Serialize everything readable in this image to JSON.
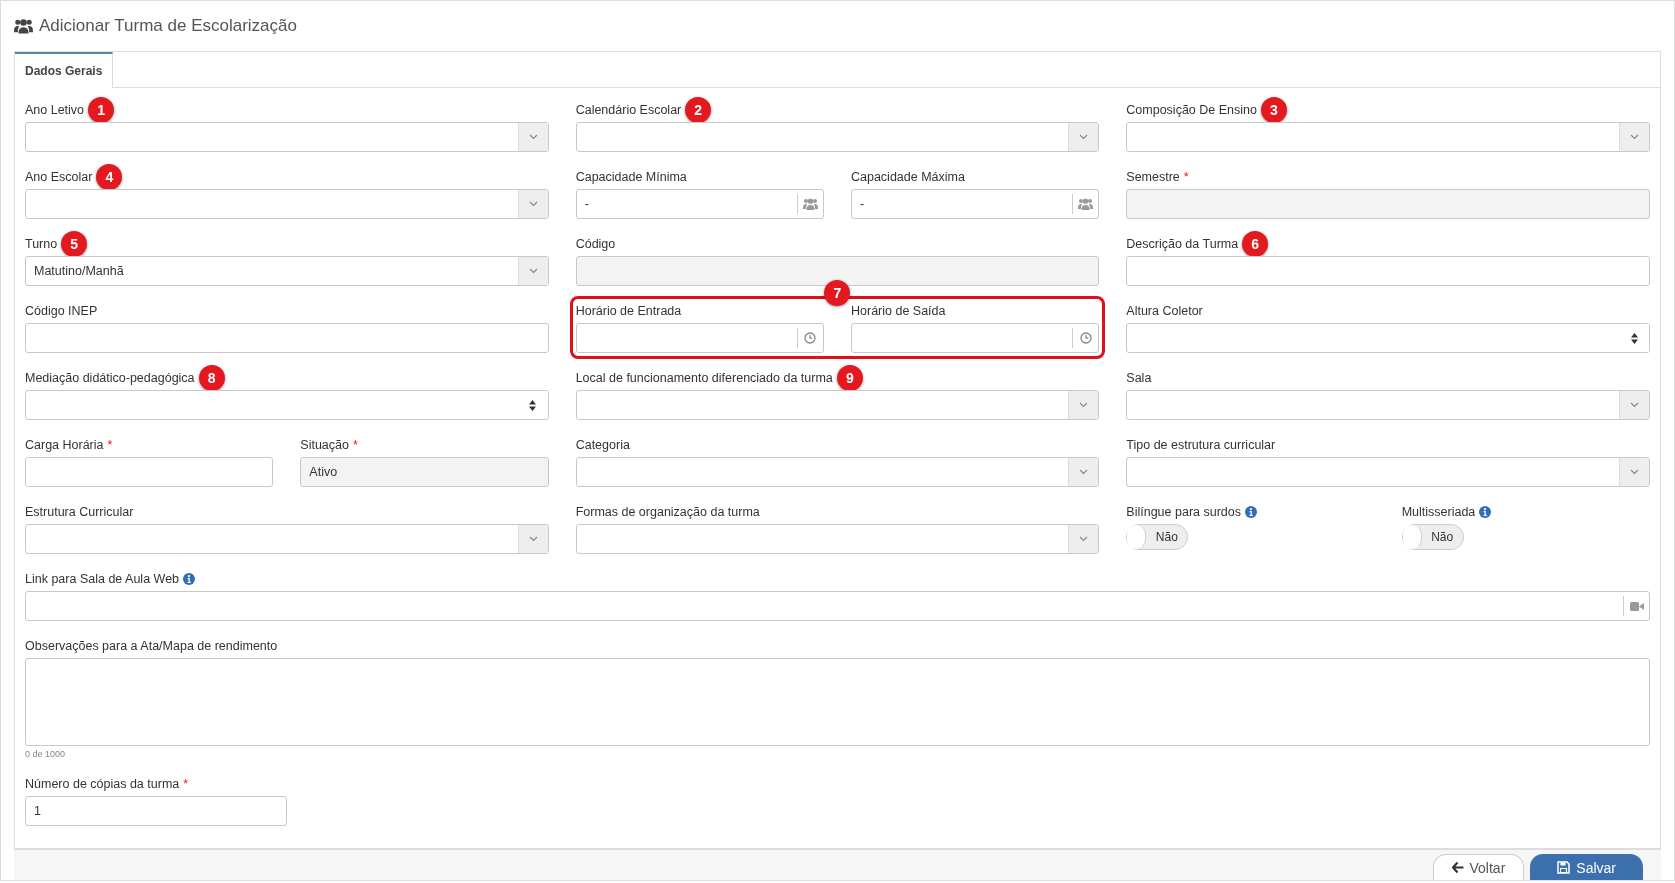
{
  "header": {
    "title": "Adicionar Turma de Escolarização"
  },
  "tabs": [
    {
      "label": "Dados Gerais",
      "selected": true
    }
  ],
  "rows": [
    {
      "cells": [
        {
          "fields": [
            {
              "label": "Ano Letivo",
              "kind": "select",
              "marker": "1"
            }
          ]
        },
        {
          "fields": [
            {
              "label": "Calendário Escolar",
              "kind": "select",
              "marker": "2"
            }
          ]
        },
        {
          "fields": [
            {
              "label": "Composição De Ensino",
              "kind": "select",
              "marker": "3"
            }
          ]
        }
      ]
    },
    {
      "cells": [
        {
          "fields": [
            {
              "label": "Ano Escolar",
              "kind": "select",
              "marker": "4"
            }
          ]
        },
        {
          "fields": [
            {
              "label": "Capacidade Mínima",
              "kind": "people",
              "value": "-"
            },
            {
              "label": "Capacidade Máxima",
              "kind": "people",
              "value": "-"
            }
          ]
        },
        {
          "fields": [
            {
              "label": "Semestre",
              "kind": "text",
              "required": "*",
              "disabled": true
            }
          ]
        }
      ]
    },
    {
      "cells": [
        {
          "fields": [
            {
              "label": "Turno",
              "kind": "select",
              "marker": "5",
              "value": "Matutino/Manhã"
            }
          ]
        },
        {
          "fields": [
            {
              "label": "Código",
              "kind": "text",
              "disabled": true
            }
          ]
        },
        {
          "fields": [
            {
              "label": "Descrição da Turma",
              "kind": "text",
              "marker": "6",
              "disabled": false
            }
          ]
        }
      ]
    },
    {
      "cells": [
        {
          "fields": [
            {
              "label": "Código INEP",
              "kind": "text",
              "disabled": false
            }
          ]
        },
        {
          "highlight": "7",
          "fields": [
            {
              "label": "Horário de Entrada",
              "kind": "time"
            },
            {
              "label": "Horário de Saída",
              "kind": "time"
            }
          ]
        },
        {
          "fields": [
            {
              "label": "Altura Coletor",
              "kind": "spinner"
            }
          ]
        }
      ]
    },
    {
      "cells": [
        {
          "fields": [
            {
              "label": "Mediação didático-pedagógica",
              "kind": "spinner",
              "marker": "8"
            }
          ]
        },
        {
          "fields": [
            {
              "label": "Local de funcionamento diferenciado da turma",
              "kind": "select",
              "marker": "9"
            }
          ]
        },
        {
          "fields": [
            {
              "label": "Sala",
              "kind": "select"
            }
          ]
        }
      ]
    },
    {
      "cells": [
        {
          "fields": [
            {
              "label": "Carga Horária",
              "kind": "text",
              "required": "*",
              "disabled": false
            },
            {
              "label": "Situação",
              "kind": "text",
              "required": "*",
              "disabled": true,
              "value": "Ativo"
            }
          ]
        },
        {
          "fields": [
            {
              "label": "Categoria",
              "kind": "select"
            }
          ]
        },
        {
          "fields": [
            {
              "label": "Tipo de estrutura curricular",
              "kind": "select"
            }
          ]
        }
      ]
    },
    {
      "cells": [
        {
          "fields": [
            {
              "label": "Estrutura Curricular",
              "kind": "select"
            }
          ]
        },
        {
          "fields": [
            {
              "label": "Formas de organização da turma",
              "kind": "select"
            }
          ]
        },
        {
          "fields": [
            {
              "label": "Bilíngue para surdos",
              "kind": "toggle",
              "info": true,
              "value": "Não",
              "on": false
            },
            {
              "label": "Multisseriada",
              "kind": "toggle",
              "info": true,
              "value": "Não",
              "on": false
            }
          ]
        }
      ]
    }
  ],
  "link_field": {
    "label": "Link para Sala de Aula Web",
    "info": true
  },
  "notes": {
    "label": "Observações para a Ata/Mapa de rendimento",
    "counter": "0 de 1000"
  },
  "copies": {
    "label": "Número de cópias da turma",
    "required": "*",
    "value": "1"
  },
  "buttons": [
    {
      "label": "Voltar",
      "kind": "back"
    },
    {
      "label": "Salvar",
      "kind": "save"
    }
  ]
}
